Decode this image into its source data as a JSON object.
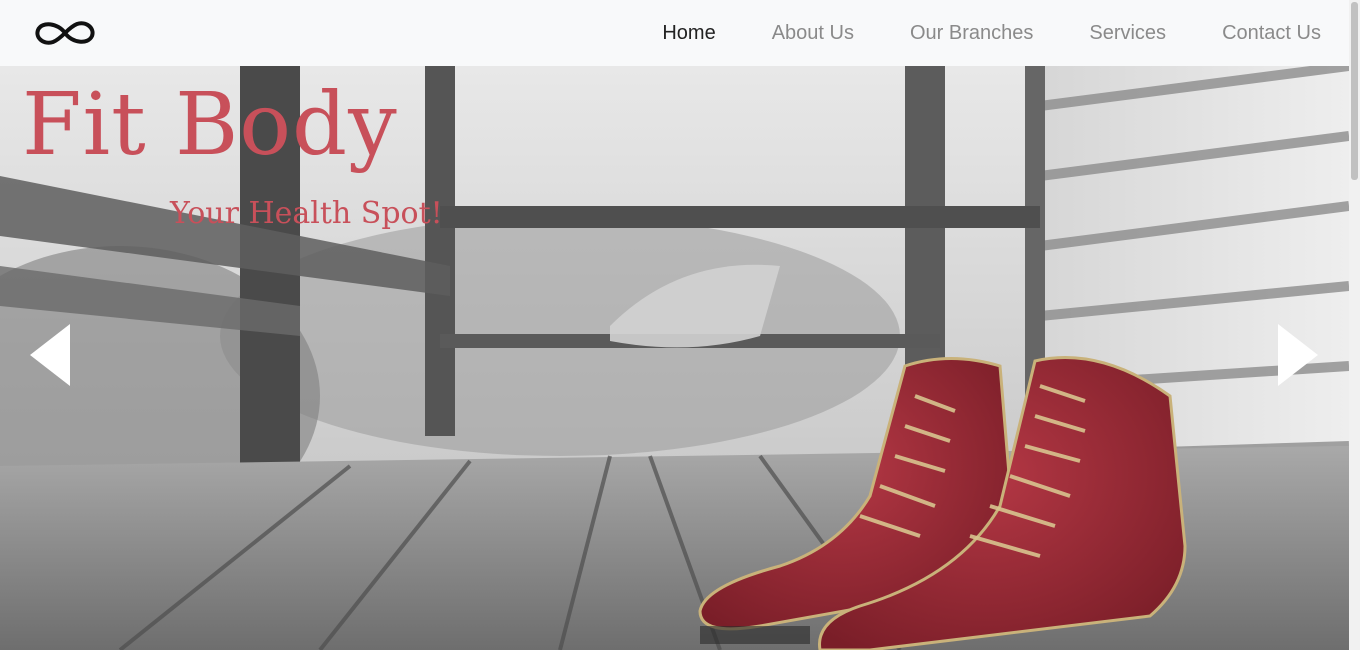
{
  "nav": {
    "logo_icon": "infinity-icon",
    "items": [
      {
        "label": "Home",
        "active": true
      },
      {
        "label": "About Us",
        "active": false
      },
      {
        "label": "Our Branches",
        "active": false
      },
      {
        "label": "Services",
        "active": false
      },
      {
        "label": "Contact Us",
        "active": false
      }
    ]
  },
  "hero": {
    "title": "Fit Body",
    "subtitle": "Your Health Spot!",
    "prev_icon": "triangle-left-icon",
    "next_icon": "triangle-right-icon"
  },
  "colors": {
    "accent": "#c8505a",
    "nav_active": "#222222",
    "nav_inactive": "#8a8a8a",
    "navbar_bg": "#f8f9fa"
  }
}
